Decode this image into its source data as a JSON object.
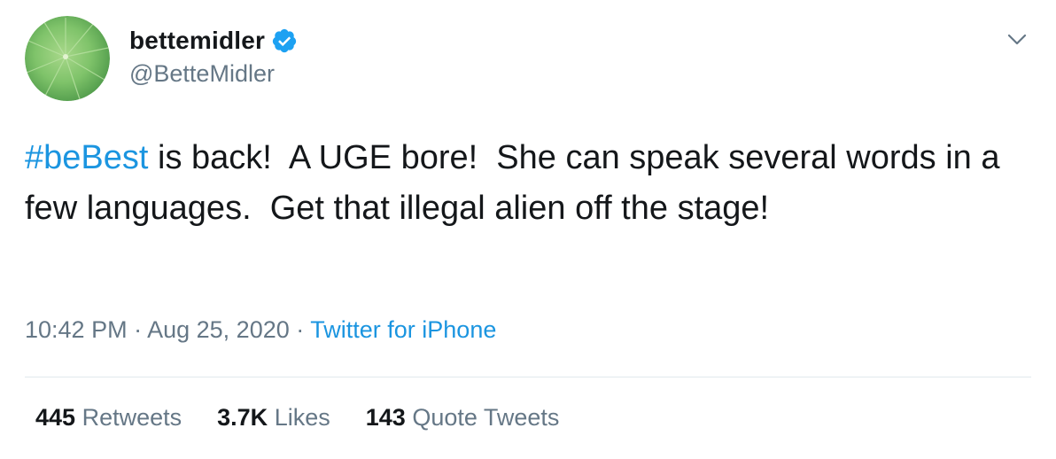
{
  "tweet": {
    "author": {
      "display_name": "bettemidler",
      "handle": "@BetteMidler",
      "verified": true,
      "avatar": "green-lily-pad-avatar"
    },
    "text": {
      "hashtag": "#beBest",
      "body": " is back!  A UGE bore!  She can speak several words in a few languages.  Get that illegal alien off the stage!"
    },
    "meta": {
      "time": "10:42 PM",
      "separator1": " · ",
      "date": "Aug 25, 2020",
      "separator2": " · ",
      "source": "Twitter for iPhone"
    },
    "stats": {
      "retweets_count": "445",
      "retweets_label": "Retweets",
      "likes_count": "3.7K",
      "likes_label": "Likes",
      "quotes_count": "143",
      "quotes_label": "Quote Tweets"
    },
    "icons": {
      "verified": "verified-badge-icon",
      "menu": "chevron-down-icon"
    },
    "colors": {
      "link": "#1b95e0",
      "text": "#14171a",
      "secondary": "#657786",
      "verified": "#1da1f2",
      "divider": "#e1e8ed"
    }
  }
}
